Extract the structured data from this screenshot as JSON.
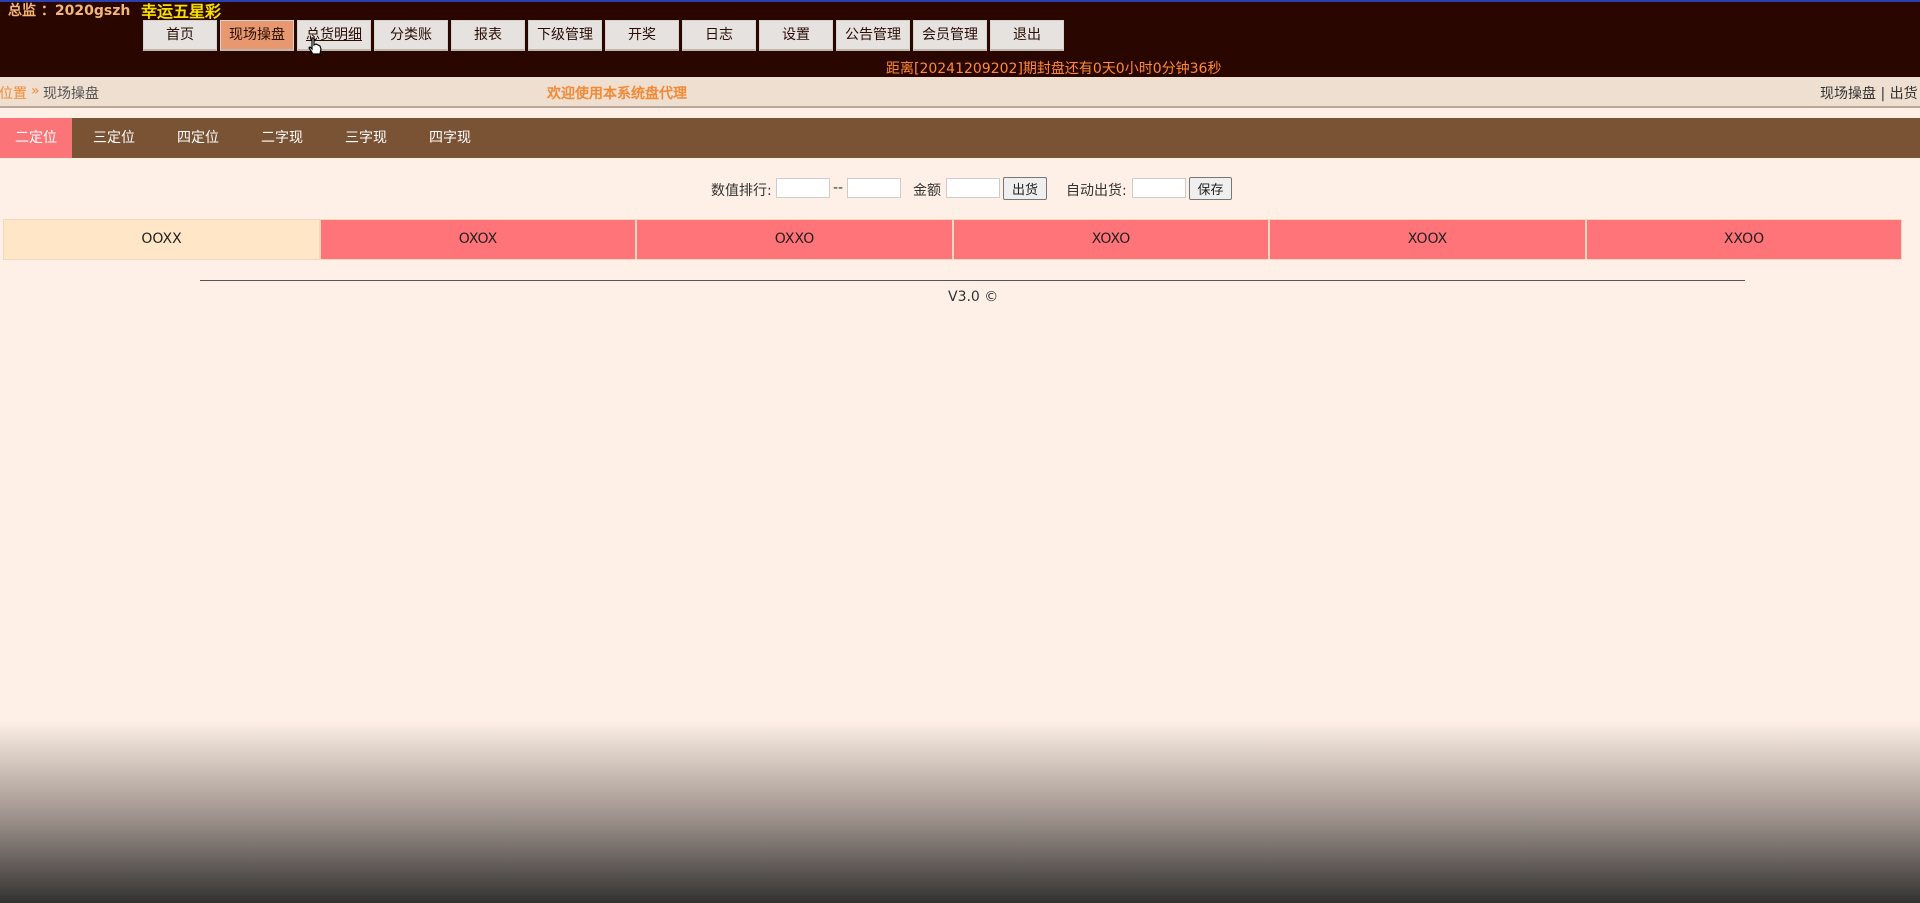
{
  "header": {
    "user_label": "总监 ：2020gszh",
    "site_name": "幸运五星彩",
    "countdown": "距离[20241209202]期封盘还有0天0小时0分钟36秒"
  },
  "nav": [
    {
      "label": "首页"
    },
    {
      "label": "现场操盘",
      "active": true
    },
    {
      "label": "总货明细",
      "hover": true
    },
    {
      "label": "分类账"
    },
    {
      "label": "报表"
    },
    {
      "label": "下级管理"
    },
    {
      "label": "开奖"
    },
    {
      "label": "日志"
    },
    {
      "label": "设置"
    },
    {
      "label": "公告管理"
    },
    {
      "label": "会员管理"
    },
    {
      "label": "退出"
    }
  ],
  "breadcrumb": {
    "home": "位置",
    "separator": "»",
    "current": "现场操盘",
    "welcome": "欢迎使用本系统盘代理",
    "right_links": "现场操盘 | 出货"
  },
  "tabs": [
    {
      "label": "二定位",
      "active": true
    },
    {
      "label": "三定位"
    },
    {
      "label": "四定位"
    },
    {
      "label": "二字现"
    },
    {
      "label": "三字现"
    },
    {
      "label": "四字现"
    }
  ],
  "form": {
    "rank_label": "数值排行:",
    "range_sep": "--",
    "amount_label": "金额",
    "ship_button": "出货",
    "auto_label": "自动出货:",
    "save_button": "保存"
  },
  "combos": [
    {
      "label": "OOXX",
      "selected": true
    },
    {
      "label": "OXOX"
    },
    {
      "label": "OXXO"
    },
    {
      "label": "XOXO"
    },
    {
      "label": "XOOX"
    },
    {
      "label": "XXOO"
    }
  ],
  "footer": {
    "version": "V3.0  ©"
  },
  "colors": {
    "topbar": "#2a0600",
    "tabbar": "#7a5234",
    "active_tab": "#fb7478",
    "combo": "#ff7479",
    "combo_selected": "#ffe6c6",
    "accent_orange": "#f08a36"
  }
}
